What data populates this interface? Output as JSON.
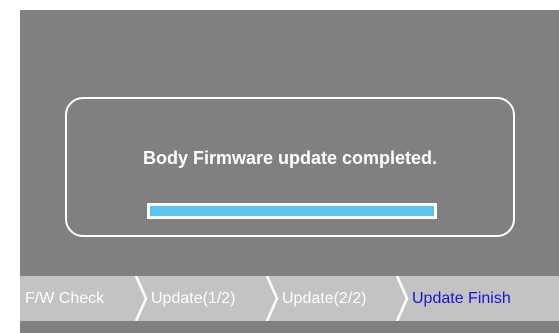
{
  "dialog": {
    "message": "Body Firmware update completed.",
    "progress_fraction": 1.0
  },
  "steps": [
    {
      "label": "F/W Check",
      "state": "done"
    },
    {
      "label": "Update(1/2)",
      "state": "done"
    },
    {
      "label": "Update(2/2)",
      "state": "done"
    },
    {
      "label": "Update Finish",
      "state": "active"
    }
  ],
  "colors": {
    "screen_bg": "#808080",
    "steps_bg": "#c3c3c3",
    "progress_fill": "#5ac4f0",
    "active_step": "#1515d8",
    "inactive_step": "#ffffff"
  }
}
